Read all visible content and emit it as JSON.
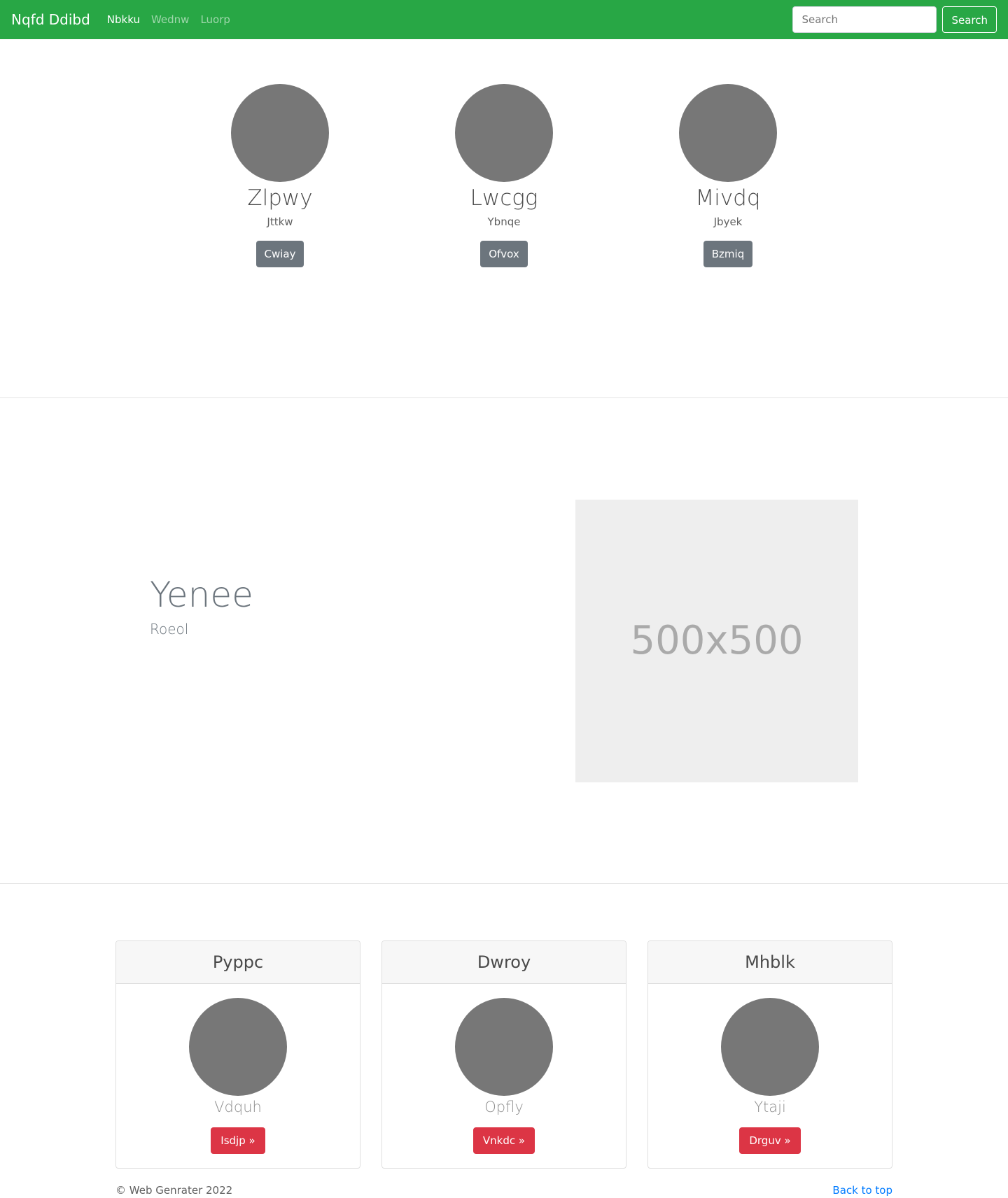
{
  "navbar": {
    "brand": "Nqfd Ddibd",
    "links": [
      {
        "label": "Nbkku",
        "active": true
      },
      {
        "label": "Wednw",
        "active": false
      },
      {
        "label": "Luorp",
        "active": false
      }
    ],
    "search": {
      "placeholder": "Search",
      "button_label": "Search"
    }
  },
  "team": [
    {
      "name": "Zlpwy",
      "role": "Jttkw",
      "button_label": "Cwiay"
    },
    {
      "name": "Lwcgg",
      "role": "Ybnqe",
      "button_label": "Ofvox"
    },
    {
      "name": "Mivdq",
      "role": "Jbyek",
      "button_label": "Bzmiq"
    }
  ],
  "feature": {
    "heading": "Yenee",
    "subtitle": "Roeol",
    "placeholder_label": "500x500"
  },
  "cards": [
    {
      "header": "Pyppc",
      "name": "Vdquh",
      "button_label": "Isdjp »"
    },
    {
      "header": "Dwroy",
      "name": "Opfly",
      "button_label": "Vnkdc »"
    },
    {
      "header": "Mhblk",
      "name": "Ytaji",
      "button_label": "Drguv »"
    }
  ],
  "footer": {
    "copyright": "© Web Genrater 2022",
    "back_to_top": "Back to top"
  },
  "colors": {
    "navbar": "#28a745",
    "secondary_button": "#6c757d",
    "danger_button": "#dc3545",
    "link": "#007bff",
    "avatar": "#777777",
    "placeholder_bg": "#eeeeee"
  }
}
